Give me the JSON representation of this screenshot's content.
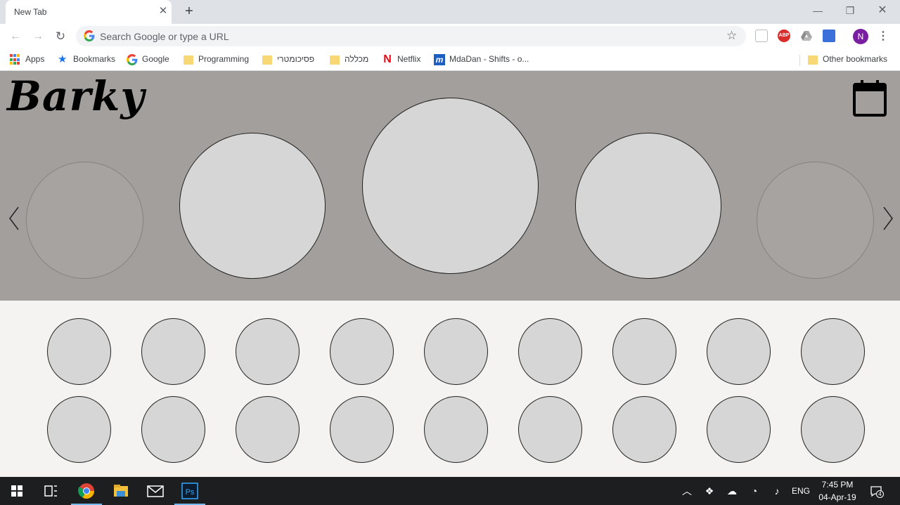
{
  "browser": {
    "tab_title": "New Tab",
    "omnibox_placeholder": "Search Google or type a URL",
    "profile_initial": "N",
    "abp_label": "ABP"
  },
  "bookmarks": [
    {
      "label": "Apps",
      "icon": "apps-grid-icon"
    },
    {
      "label": "Bookmarks",
      "icon": "star-icon"
    },
    {
      "label": "Google",
      "icon": "google-g-icon"
    },
    {
      "label": "Programming",
      "icon": "folder-icon"
    },
    {
      "label": "פסיכומטרי",
      "icon": "folder-icon"
    },
    {
      "label": "מכללה",
      "icon": "folder-icon"
    },
    {
      "label": "Netflix",
      "icon": "netflix-icon"
    },
    {
      "label": "MdaDan - Shifts - o...",
      "icon": "mdadan-icon"
    }
  ],
  "other_bookmarks": "Other bookmarks",
  "page": {
    "logo_text": "Barky"
  },
  "taskbar": {
    "language": "ENG",
    "time": "7:45 PM",
    "date": "04-Apr-19",
    "notification_count": "4"
  },
  "colors": {
    "hero_bg": "#a39f9d",
    "content_bg": "#f4f3f1",
    "circle_fill": "#d6d6d6",
    "taskbar_bg": "#1c1e20",
    "avatar": "#7b1fa2",
    "abp": "#d92d2d",
    "netflix": "#e50914",
    "mdadan": "#1b5fc4"
  }
}
